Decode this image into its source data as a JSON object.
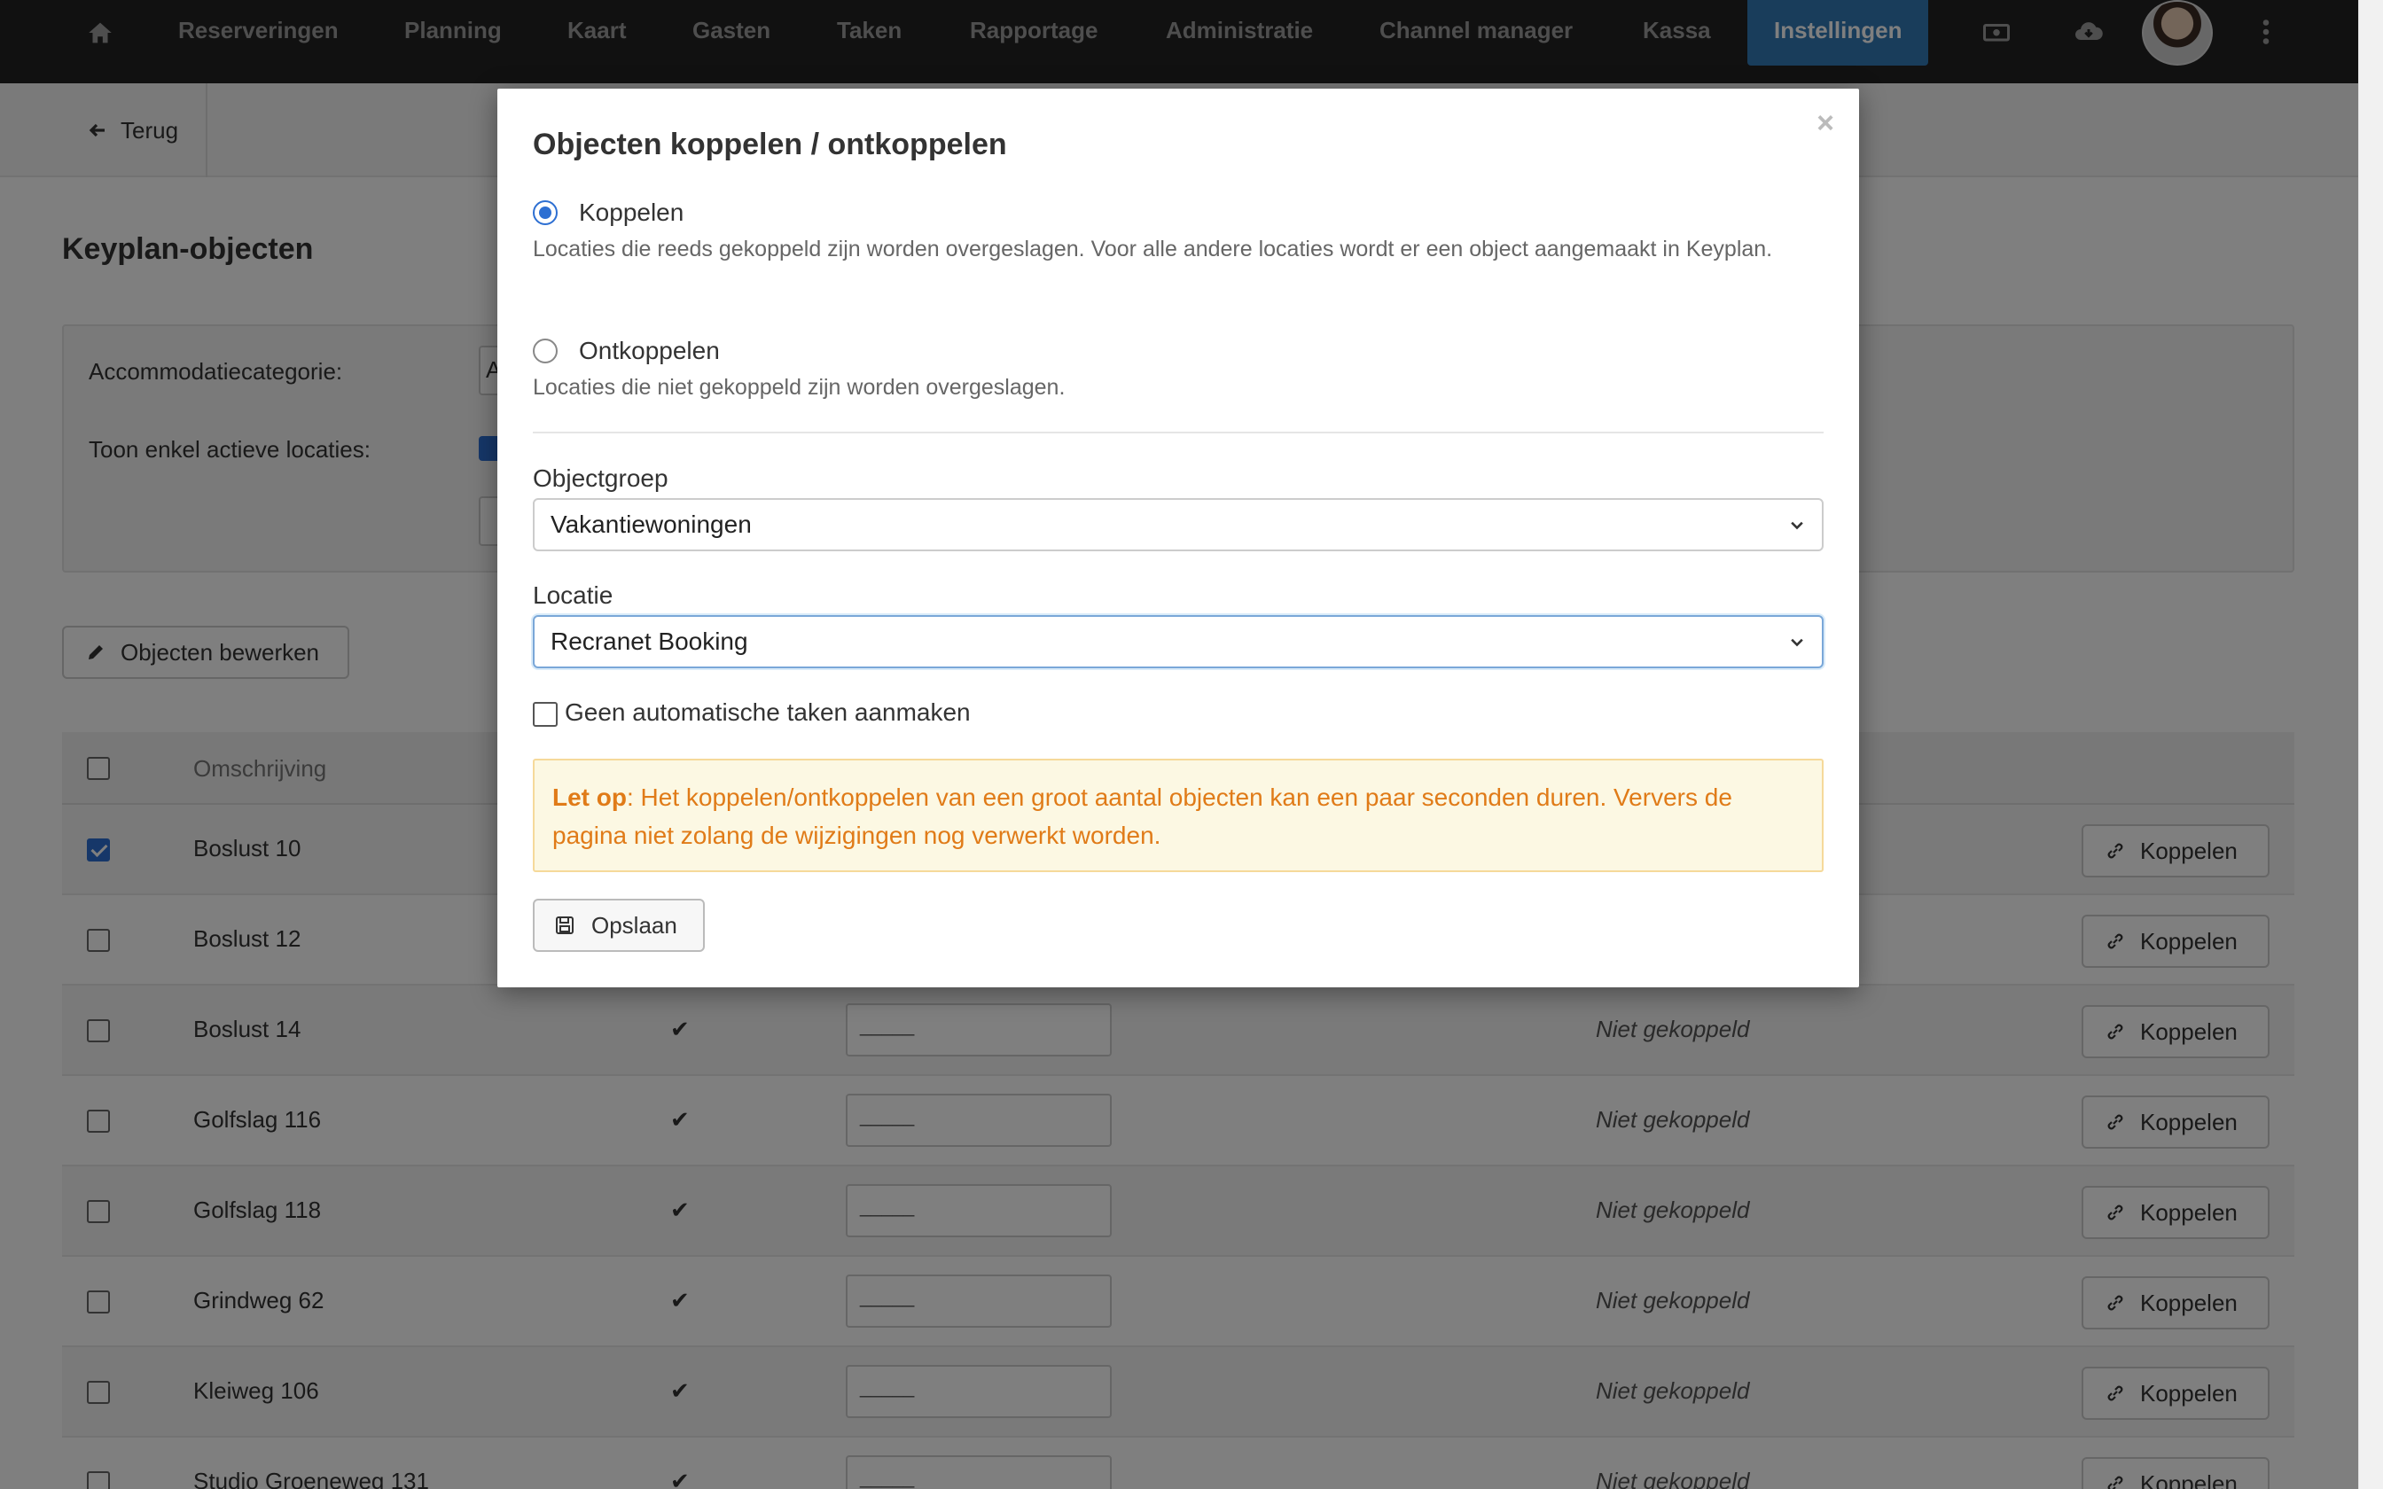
{
  "nav": {
    "home_icon": "home-icon",
    "items": [
      "Reserveringen",
      "Planning",
      "Kaart",
      "Gasten",
      "Taken",
      "Rapportage",
      "Administratie",
      "Channel manager",
      "Kassa"
    ],
    "active": "Instellingen",
    "icons": [
      "cash-register-icon",
      "cloud-download-icon",
      "avatar",
      "kebab-menu-icon"
    ]
  },
  "subbar": {
    "back_label": "Terug"
  },
  "page": {
    "title": "Keyplan-objecten",
    "filter_category_label": "Accommodatiecategorie:",
    "filter_category_value": "A",
    "filter_active_label": "Toon enkel actieve locaties:",
    "edit_button": "Objecten bewerken"
  },
  "table": {
    "header": "Omschrijving",
    "rows": [
      {
        "name": "Boslust 10",
        "checked": true,
        "active": "✔",
        "input": "",
        "status": "",
        "button": "Koppelen"
      },
      {
        "name": "Boslust 12",
        "checked": false,
        "active": "✔",
        "input": "",
        "status": "",
        "button": "Koppelen"
      },
      {
        "name": "Boslust 14",
        "checked": false,
        "active": "✔",
        "input": "_____",
        "status": "Niet gekoppeld",
        "button": "Koppelen"
      },
      {
        "name": "Golfslag 116",
        "checked": false,
        "active": "✔",
        "input": "_____",
        "status": "Niet gekoppeld",
        "button": "Koppelen"
      },
      {
        "name": "Golfslag 118",
        "checked": false,
        "active": "✔",
        "input": "_____",
        "status": "Niet gekoppeld",
        "button": "Koppelen"
      },
      {
        "name": "Grindweg 62",
        "checked": false,
        "active": "✔",
        "input": "_____",
        "status": "Niet gekoppeld",
        "button": "Koppelen"
      },
      {
        "name": "Kleiweg 106",
        "checked": false,
        "active": "✔",
        "input": "_____",
        "status": "Niet gekoppeld",
        "button": "Koppelen"
      },
      {
        "name": "Studio Groeneweg 131",
        "checked": false,
        "active": "✔",
        "input": "_____",
        "status": "Niet gekoppeld",
        "button": "Koppelen"
      }
    ]
  },
  "modal": {
    "title": "Objecten koppelen / ontkoppelen",
    "close": "×",
    "option_link": {
      "label": "Koppelen",
      "help": "Locaties die reeds gekoppeld zijn worden overgeslagen. Voor alle andere locaties wordt er een object aangemaakt in Keyplan.",
      "selected": true
    },
    "option_unlink": {
      "label": "Ontkoppelen",
      "help": "Locaties die niet gekoppeld zijn worden overgeslagen.",
      "selected": false
    },
    "objectgroup_label": "Objectgroep",
    "objectgroup_value": "Vakantiewoningen",
    "location_label": "Locatie",
    "location_value": "Recranet Booking",
    "no_tasks_label": "Geen automatische taken aanmaken",
    "alert_strong": "Let op",
    "alert_text": ": Het koppelen/ontkoppelen van een groot aantal objecten kan een paar seconden duren. Ververs de pagina niet zolang de wijzigingen nog verwerkt worden.",
    "save_label": "Opslaan"
  },
  "colors": {
    "primary": "#337ab7",
    "checkbox": "#2d6fd2",
    "warning_text": "#e07b18",
    "warning_bg": "#fcf8e3"
  }
}
